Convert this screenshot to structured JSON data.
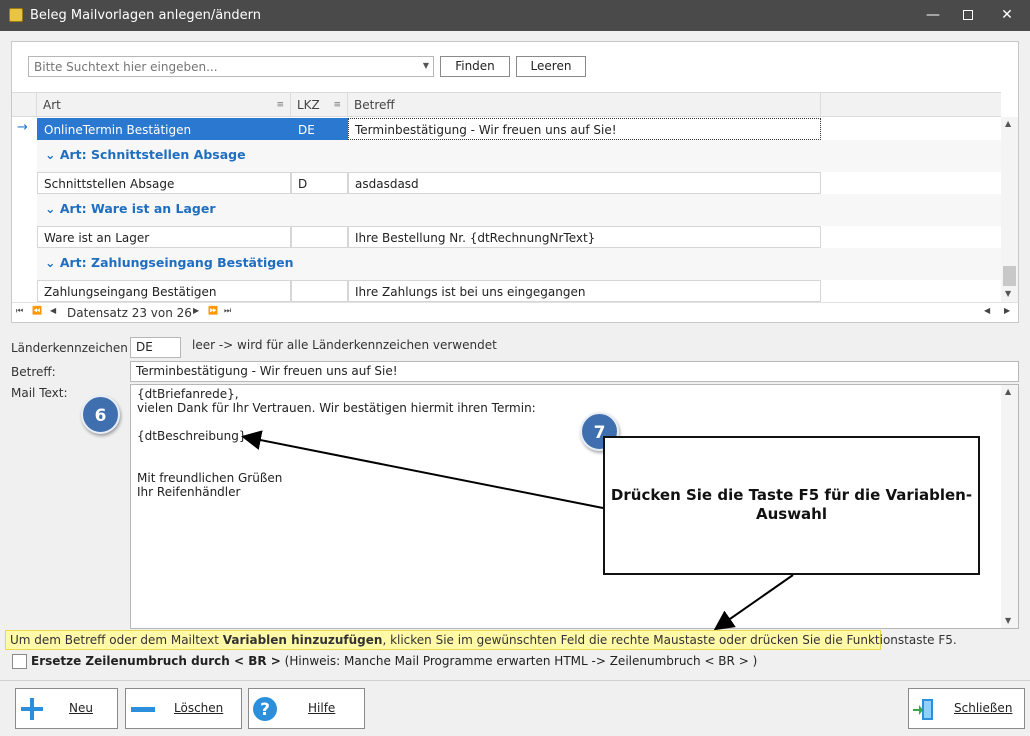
{
  "window": {
    "title": "Beleg Mailvorlagen anlegen/ändern",
    "minimize_icon": "minimize-icon",
    "maximize_icon": "maximize-icon",
    "close_icon": "close-icon"
  },
  "search": {
    "placeholder": "Bitte Suchtext hier eingeben...",
    "find_label": "Finden",
    "clear_label": "Leeren"
  },
  "grid": {
    "columns": [
      "Art",
      "LKZ",
      "Betreff"
    ],
    "rows": [
      {
        "type": "row",
        "art": "OnlineTermin Bestätigen",
        "lkz": "DE",
        "betreff": "Terminbestätigung - Wir freuen uns auf Sie!",
        "selected": true
      },
      {
        "type": "group",
        "label": "Art: Schnittstellen Absage"
      },
      {
        "type": "row",
        "art": "Schnittstellen Absage",
        "lkz": "D",
        "betreff": "asdasdasd"
      },
      {
        "type": "group",
        "label": "Art: Ware ist an Lager"
      },
      {
        "type": "row",
        "art": "Ware ist an Lager",
        "lkz": "",
        "betreff": "Ihre Bestellung Nr. {dtRechnungNrText}"
      },
      {
        "type": "group",
        "label": "Art: Zahlungseingang Bestätigen"
      },
      {
        "type": "row",
        "art": "Zahlungseingang Bestätigen",
        "lkz": "",
        "betreff": "Ihre Zahlungs ist bei uns eingegangen"
      }
    ],
    "navigator_text": "Datensatz 23 von 26"
  },
  "form": {
    "lkz_label": "Länderkennzeichen",
    "lkz_value": "DE",
    "lkz_hint": "leer -> wird für alle Länderkennzeichen verwendet",
    "betreff_label": "Betreff:",
    "betreff_value": "Terminbestätigung - Wir freuen uns auf Sie!",
    "mailtext_label": "Mail Text:",
    "mailtext_lines": [
      "{dtBriefanrede},",
      "vielen Dank für Ihr Vertrauen. Wir bestätigen hiermit ihren Termin:",
      "",
      "{dtBeschreibung}",
      "",
      "",
      "Mit freundlichen Grüßen",
      "Ihr Reifenhändler"
    ]
  },
  "annotations": {
    "badge_6": "6",
    "badge_7": "7",
    "callout_text": "Drücken Sie die Taste F5 für die Variablen-Auswahl"
  },
  "hint": {
    "prefix": "Um dem Betreff oder dem Mailtext ",
    "bold": "Variablen hinzuzufügen",
    "suffix": ", klicken Sie im gewünschten Feld die rechte Maustaste oder drücken Sie die Funktionstaste F5."
  },
  "checkbox": {
    "checked": false,
    "bold_label": "Ersetze Zeilenumbruch durch < BR >",
    "note": " (Hinweis: Manche Mail Programme erwarten HTML -> Zeilenumbruch <  BR > )"
  },
  "buttons": {
    "new_label": "Neu",
    "delete_label": "Löschen",
    "help_label": "Hilfe",
    "close_label": "Schließen"
  },
  "colors": {
    "titlebar": "#4a4a4a",
    "selection": "#2b78d0",
    "group_text": "#1f6ec0",
    "badge": "#3f6fae",
    "hint_bg": "#fff9a8"
  }
}
